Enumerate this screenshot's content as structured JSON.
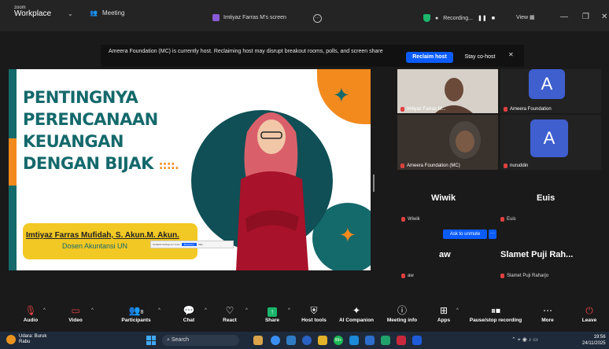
{
  "titlebar": {
    "brand_top": "zoom",
    "brand_main": "Workplace",
    "meeting_label": "Meeting",
    "screen_label": "Imtiyaz Farras M's screen",
    "recording_label": "Recording...",
    "view_label": "View"
  },
  "banner": {
    "message": "Ameera Foundation (MC) is currently host. Reclaiming host may disrupt breakout rooms, polls, and screen share",
    "reclaim_label": "Reclaim host",
    "stay_label": "Stay co-host"
  },
  "slide": {
    "title_lines": [
      "PENTINGNYA",
      "PERENCANAAN",
      "KEUANGAN",
      "DENGAN BIJAK"
    ],
    "dots": "::::.",
    "presenter_name": "Imtiyaz Farras Mufidah, S. Akun.M. Akun.",
    "presenter_role": "Dosen Akuntansi UN",
    "tooltip_text": "Updated settings for zoom",
    "tooltip_button": "Recovery",
    "tooltip_hide": "Hide"
  },
  "gallery": {
    "tiles": [
      {
        "label": "Imtiyaz Farras M..."
      },
      {
        "label": "Ameera Foundation",
        "avatar": "A"
      },
      {
        "label": "Ameera Foundation (MC)"
      },
      {
        "label": "nuruddin",
        "avatar": "A"
      }
    ],
    "names": [
      {
        "big": "Wiwik",
        "small": "Wiwik"
      },
      {
        "big": "Euis",
        "small": "Euis"
      },
      {
        "big": "aw",
        "small": "aw"
      },
      {
        "big": "Slamet Puji Rah...",
        "small": "Slamet Puji Raharjo"
      }
    ],
    "ask_unmute": "Ask to unmute",
    "ask_more": "···"
  },
  "toolbar": {
    "items": [
      "Audio",
      "Video",
      "Participants",
      "Chat",
      "React",
      "Share",
      "Host tools",
      "AI Companion",
      "Meeting info",
      "Apps",
      "Pause/stop recording",
      "More",
      "Leave"
    ],
    "participant_count": "8"
  },
  "taskbar": {
    "weather_line1": "Udara: Buruk",
    "weather_line2": "Rabu",
    "search_placeholder": "Search",
    "badge": "99+",
    "time": "19:56",
    "date": "24/11/2025"
  },
  "colors": {
    "accent_blue": "#0b5cff",
    "slide_teal": "#14696b",
    "slide_orange": "#f28a1e",
    "name_box_yellow": "#f2c824",
    "avatar_blue": "#3f5fcf"
  }
}
